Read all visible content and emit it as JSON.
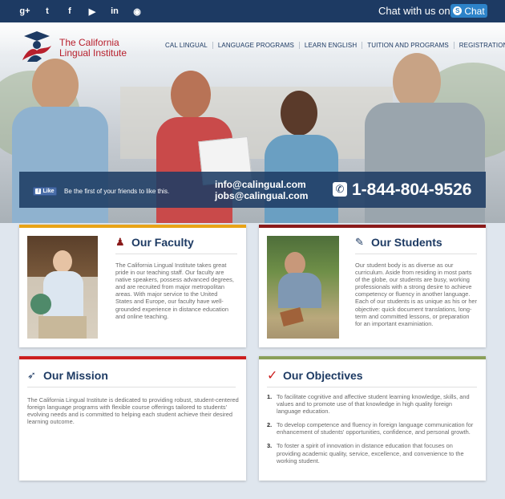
{
  "social": {
    "icons": [
      "google-plus-icon",
      "twitter-icon",
      "facebook-icon",
      "youtube-icon",
      "linkedin-icon",
      "rss-icon"
    ],
    "glyphs": [
      "g+",
      "t",
      "f",
      "▶",
      "in",
      "◉"
    ]
  },
  "chat": {
    "label": "Chat with us on",
    "button": "Chat"
  },
  "logo": {
    "line1": "The California",
    "line2": "Lingual Institute"
  },
  "nav": [
    "CAL LINGUAL",
    "LANGUAGE PROGRAMS",
    "LEARN ENGLISH",
    "TUITION AND PROGRAMS",
    "REGISTRATION"
  ],
  "contact": {
    "like": "Like",
    "like_text": "Be the first of your friends to like this.",
    "email1": "info@calingual.com",
    "email2": "jobs@calingual.com",
    "phone": "1-844-804-9526"
  },
  "faculty": {
    "title": "Our Faculty",
    "text": "The California Lingual Institute takes great pride in our teaching staff. Our faculty are native speakers, possess advanced degrees, and are recruited from major metropolitan areas. With major service to the United States and Europe, our faculty have well-grounded experience in distance education and online teaching."
  },
  "students": {
    "title": "Our Students",
    "text": "Our student body is as diverse as our curriculum. Aside from residing in most parts of the globe, our students are busy, working professionals with a strong desire to achieve competency or fluency in another language. Each of our students is as unique as his or her objective: quick document translations, long-term and committed lessons, or preparation for an important examiniation."
  },
  "mission": {
    "title": "Our Mission",
    "text": "The California Lingual Institute is dedicated to providing robust, student-centered foreign language programs with flexible course offerings tailored to students' evolving needs and is committed to helping each student achieve their desired learning outcome."
  },
  "objectives": {
    "title": "Our Objectives",
    "items": [
      "To facilitate cognitive and affective student learning knowledge, skills, and values and to promote use of that knowledge in high quality foreign language education.",
      "To develop competence and fluency in foreign language communication for enhancement of students' opportunities, confidence, and personal growth.",
      "To foster a spirit of innovation in distance education that focuses on providing academic quality, service, excellence, and convenience to the working student."
    ],
    "numbers": [
      "1.",
      "2.",
      "3."
    ]
  },
  "colors": {
    "navy": "#1d3a63",
    "faculty_bar": "#e8a317",
    "students_bar": "#8a1a1a",
    "mission_bar": "#cc1f1f",
    "objectives_bar": "#8aa05a",
    "logo_red": "#b8202d"
  }
}
